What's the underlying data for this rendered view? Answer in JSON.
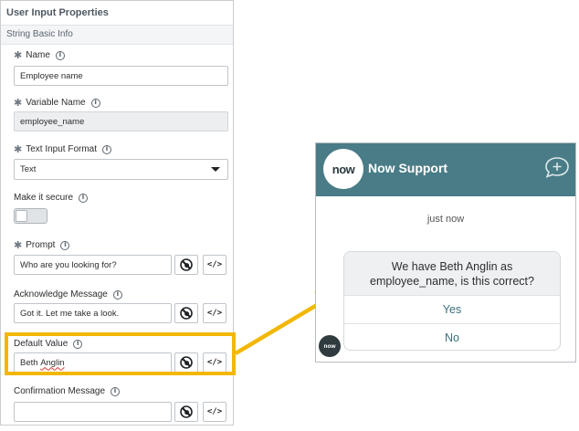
{
  "panel": {
    "title": "User Input Properties",
    "section": "String Basic Info",
    "fields": {
      "name": {
        "label": "Name",
        "value": "Employee name"
      },
      "variable_name": {
        "label": "Variable Name",
        "value": "employee_name"
      },
      "text_input_format": {
        "label": "Text Input Format",
        "value": "Text"
      },
      "make_it_secure": {
        "label": "Make it secure",
        "enabled": false
      },
      "prompt": {
        "label": "Prompt",
        "value": "Who are you looking for?"
      },
      "acknowledge_message": {
        "label": "Acknowledge Message",
        "value": "Got it. Let me take a look."
      },
      "default_value": {
        "label": "Default Value",
        "value_first": "Beth",
        "value_second": "Anglin"
      },
      "confirmation_message": {
        "label": "Confirmation Message",
        "value": ""
      }
    },
    "icons": {
      "script_button": "data-pill-icon",
      "code_button": "code-icon",
      "code_glyph": "</>"
    }
  },
  "highlight_color": "#f2b705",
  "chat": {
    "logo_text": "now",
    "title": "Now Support",
    "header_color": "#497c86",
    "timestamp": "just now",
    "message": "We have Beth Anglin as employee_name, is this correct?",
    "choices": [
      "Yes",
      "No"
    ],
    "avatar_text": "now"
  }
}
